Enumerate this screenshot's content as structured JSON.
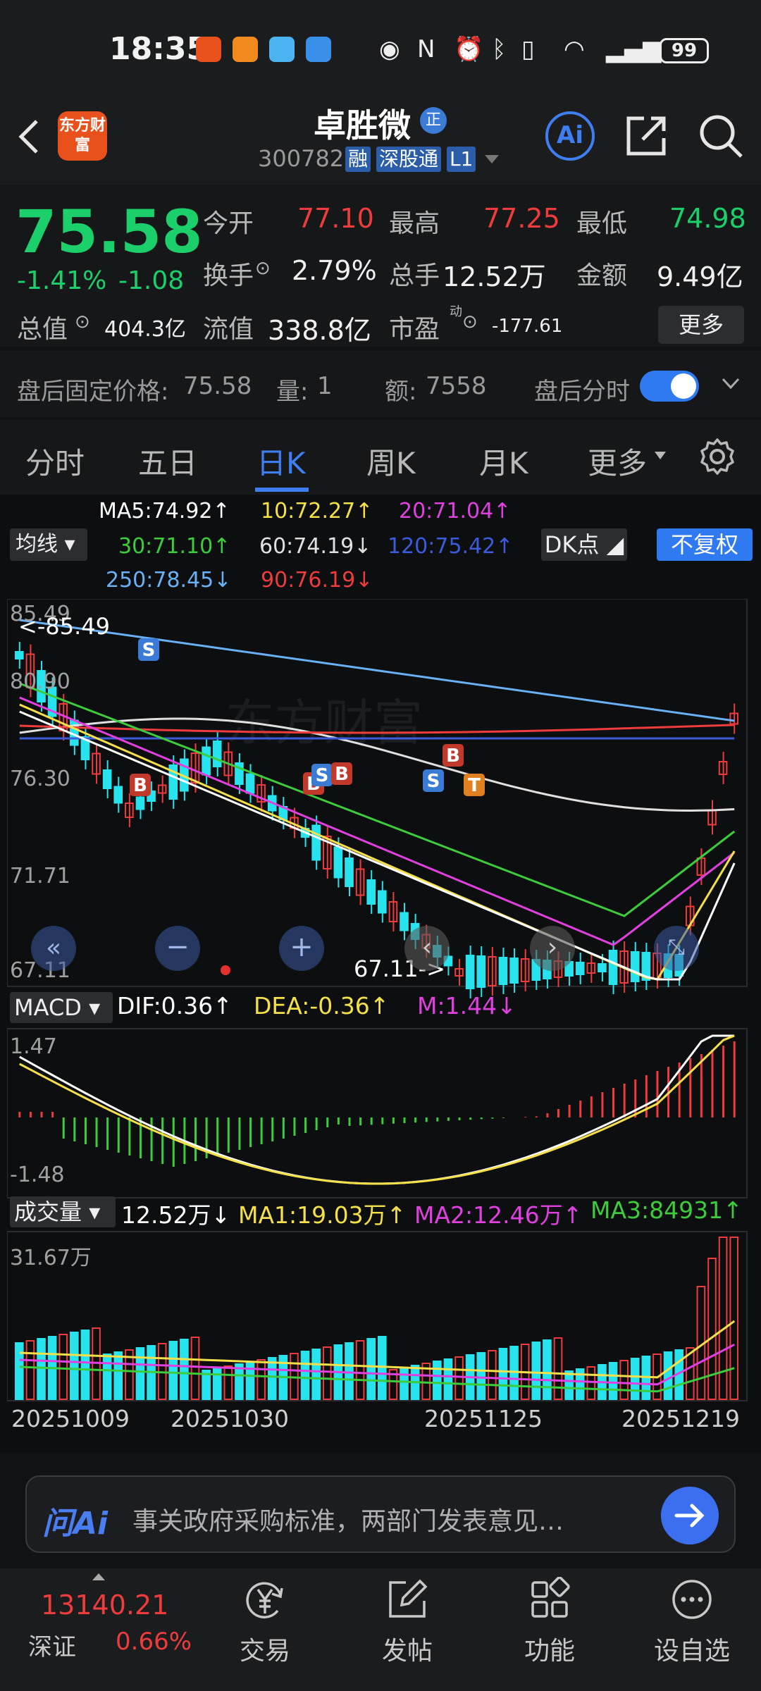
{
  "status": {
    "time": "18:35",
    "battery": "99"
  },
  "header": {
    "name": "卓胜微",
    "badge": "正",
    "code": "300782",
    "tags": [
      "融",
      "深股通",
      "L1"
    ],
    "logo": "东方财富",
    "ai": "Ai"
  },
  "quote": {
    "price": "75.58",
    "pct": "-1.41%",
    "chg": "-1.08",
    "open_label": "今开",
    "open": "77.10",
    "high_label": "最高",
    "high": "77.25",
    "low_label": "最低",
    "low": "74.98",
    "turnover_label": "换手",
    "turnover": "2.79%",
    "volume_label": "总手",
    "volume": "12.52万",
    "amount_label": "金额",
    "amount": "9.49亿",
    "mktcap_label": "总值",
    "mktcap": "404.3亿",
    "float_label": "流值",
    "float": "338.8亿",
    "pe_label": "市盈",
    "pe_sup": "动",
    "pe": "-177.61",
    "more": "更多"
  },
  "after_hours": {
    "price_label": "盘后固定价格:",
    "price": "75.58",
    "vol_label": "量:",
    "vol": "1",
    "amt_label": "额:",
    "amt": "7558",
    "toggle_label": "盘后分时",
    "toggle_on": true
  },
  "tabs": [
    "分时",
    "五日",
    "日K",
    "周K",
    "月K",
    "更多"
  ],
  "active_tab": "日K",
  "chart": {
    "ma_button": "均线",
    "ma_values": [
      {
        "text": "MA5:74.92↑",
        "color": "#ffffff"
      },
      {
        "text": "10:72.27↑",
        "color": "#f5e04a"
      },
      {
        "text": "20:71.04↑",
        "color": "#e040e0"
      },
      {
        "text": "30:71.10↑",
        "color": "#3ccc3c"
      },
      {
        "text": "60:74.19↓",
        "color": "#e0e0e0"
      },
      {
        "text": "120:75.42↑",
        "color": "#3b5bdb"
      },
      {
        "text": "250:78.45↓",
        "color": "#6ab0f5"
      },
      {
        "text": "90:76.19↓",
        "color": "#ee3b3b"
      }
    ],
    "dk_button": "DK点",
    "fq_button": "不复权",
    "y_ticks": [
      "85.49",
      "80.90",
      "76.30",
      "71.71",
      "67.11"
    ],
    "high_marker": "<-85.49",
    "low_marker": "67.11->",
    "watermark": "东方财富"
  },
  "macd": {
    "button": "MACD",
    "dif": "DIF:0.36↑",
    "dea": "DEA:-0.36↑",
    "m": "M:1.44↓",
    "top": "1.47",
    "bottom": "-1.48"
  },
  "volume": {
    "button": "成交量",
    "vol": "12.52万↓",
    "ma1": "MA1:19.03万↑",
    "ma2": "MA2:12.46万↑",
    "ma3": "MA3:84931↑",
    "top": "31.67万"
  },
  "dates": [
    "20251009",
    "20251030",
    "20251125",
    "20251219"
  ],
  "ask": {
    "logo": "问Ai",
    "placeholder": "事关政府采购标准，两部门发表意见…"
  },
  "nav": {
    "index_value": "13140.21",
    "index_name": "深证",
    "index_pct": "0.66%",
    "items": [
      "交易",
      "发帖",
      "功能",
      "设自选"
    ]
  }
}
